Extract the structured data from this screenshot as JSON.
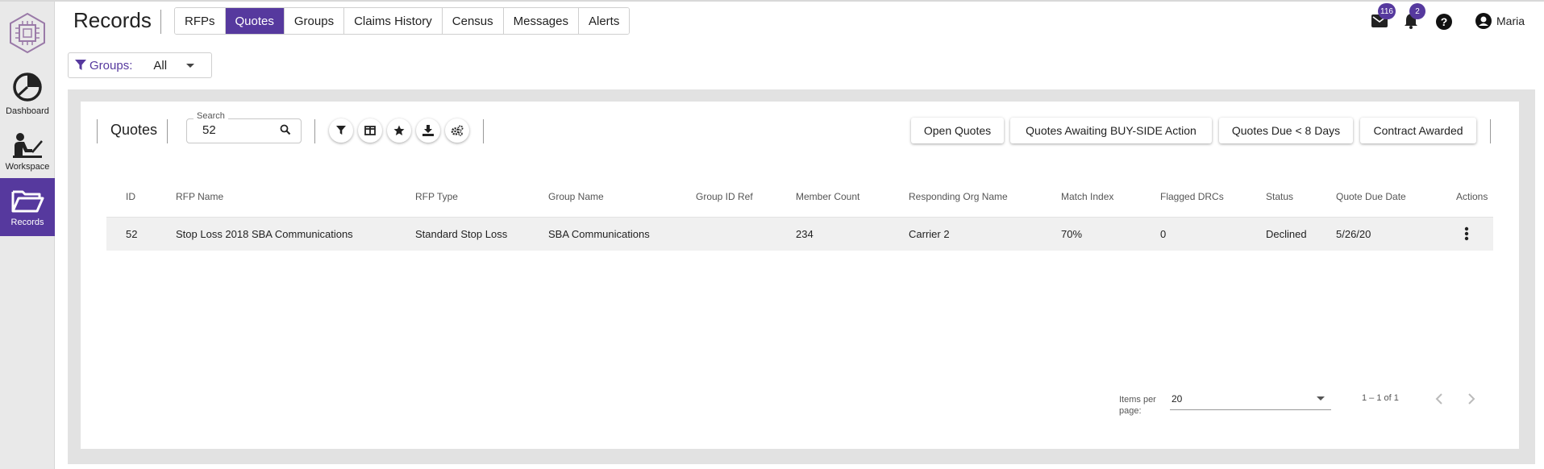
{
  "colors": {
    "accent": "#56399e",
    "sidebar_bg": "#e9e9e9"
  },
  "sidebar": {
    "items": [
      {
        "label": "Dashboard",
        "icon": "pie-chart-icon",
        "active": false
      },
      {
        "label": "Workspace",
        "icon": "person-at-laptop-icon",
        "active": false
      },
      {
        "label": "Records",
        "icon": "folder-open-icon",
        "active": true
      }
    ]
  },
  "header": {
    "title": "Records",
    "tabs": [
      {
        "label": "RFPs",
        "active": false
      },
      {
        "label": "Quotes",
        "active": true
      },
      {
        "label": "Groups",
        "active": false
      },
      {
        "label": "Claims History",
        "active": false
      },
      {
        "label": "Census",
        "active": false
      },
      {
        "label": "Messages",
        "active": false
      },
      {
        "label": "Alerts",
        "active": false
      }
    ],
    "mail_count": "116",
    "alert_count": "2",
    "user_name": "Maria"
  },
  "groups_filter": {
    "label": "Groups:",
    "value": "All"
  },
  "toolbar": {
    "section_title": "Quotes",
    "search": {
      "label": "Search",
      "value": "52"
    },
    "icon_buttons": [
      "filter-icon",
      "columns-icon",
      "star-icon",
      "download-icon",
      "settings-gears-icon"
    ],
    "quick_filters": [
      "Open Quotes",
      "Quotes Awaiting BUY-SIDE Action",
      "Quotes Due < 8 Days",
      "Contract Awarded"
    ]
  },
  "table": {
    "columns": [
      "ID",
      "RFP Name",
      "RFP Type",
      "Group Name",
      "Group ID Ref",
      "Member Count",
      "Responding Org Name",
      "Match Index",
      "Flagged DRCs",
      "Status",
      "Quote Due Date",
      "Actions"
    ],
    "rows": [
      [
        "52",
        "Stop Loss 2018 SBA Communications",
        "Standard Stop Loss",
        "SBA Communications",
        "",
        "234",
        "Carrier 2",
        "70%",
        "0",
        "Declined",
        "5/26/20"
      ]
    ]
  },
  "pagination": {
    "items_per_page_label": "Items per page:",
    "items_per_page": "20",
    "range": "1 – 1 of 1"
  }
}
